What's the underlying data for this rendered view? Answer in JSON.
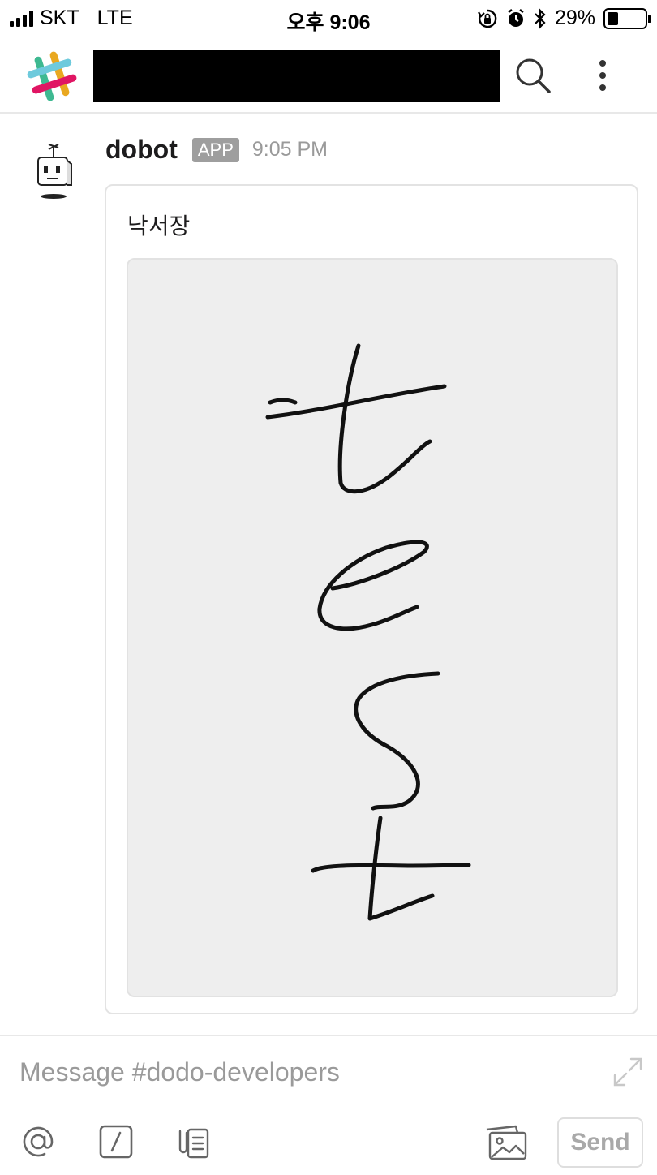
{
  "status_bar": {
    "carrier": "SKT",
    "network": "LTE",
    "time": "오후 9:06",
    "battery_percent": "29%",
    "battery_level": 0.29,
    "icons": [
      "signal-icon",
      "rotation-lock-icon",
      "alarm-icon",
      "bluetooth-icon",
      "battery-icon"
    ]
  },
  "header": {
    "channel_title": "",
    "channel_title_redacted": true,
    "icons": [
      "slack-logo-icon",
      "search-icon",
      "more-vertical-icon"
    ]
  },
  "message": {
    "sender": "dobot",
    "badge": "APP",
    "timestamp": "9:05 PM",
    "attachment": {
      "title": "낙서장",
      "image_content": "handwritten drawing of the word test, written vertically one letter per line"
    }
  },
  "composer": {
    "placeholder": "Message #dodo-developers",
    "value": "",
    "send_label": "Send",
    "tools": [
      "mention-icon",
      "slash-command-icon",
      "attach-file-icon",
      "photo-icon",
      "expand-icon"
    ]
  },
  "colors": {
    "badge_bg": "#9e9e9e",
    "canvas_bg": "#eeeeee",
    "muted_text": "#9a9a9a",
    "divider": "#e8e8e8"
  }
}
